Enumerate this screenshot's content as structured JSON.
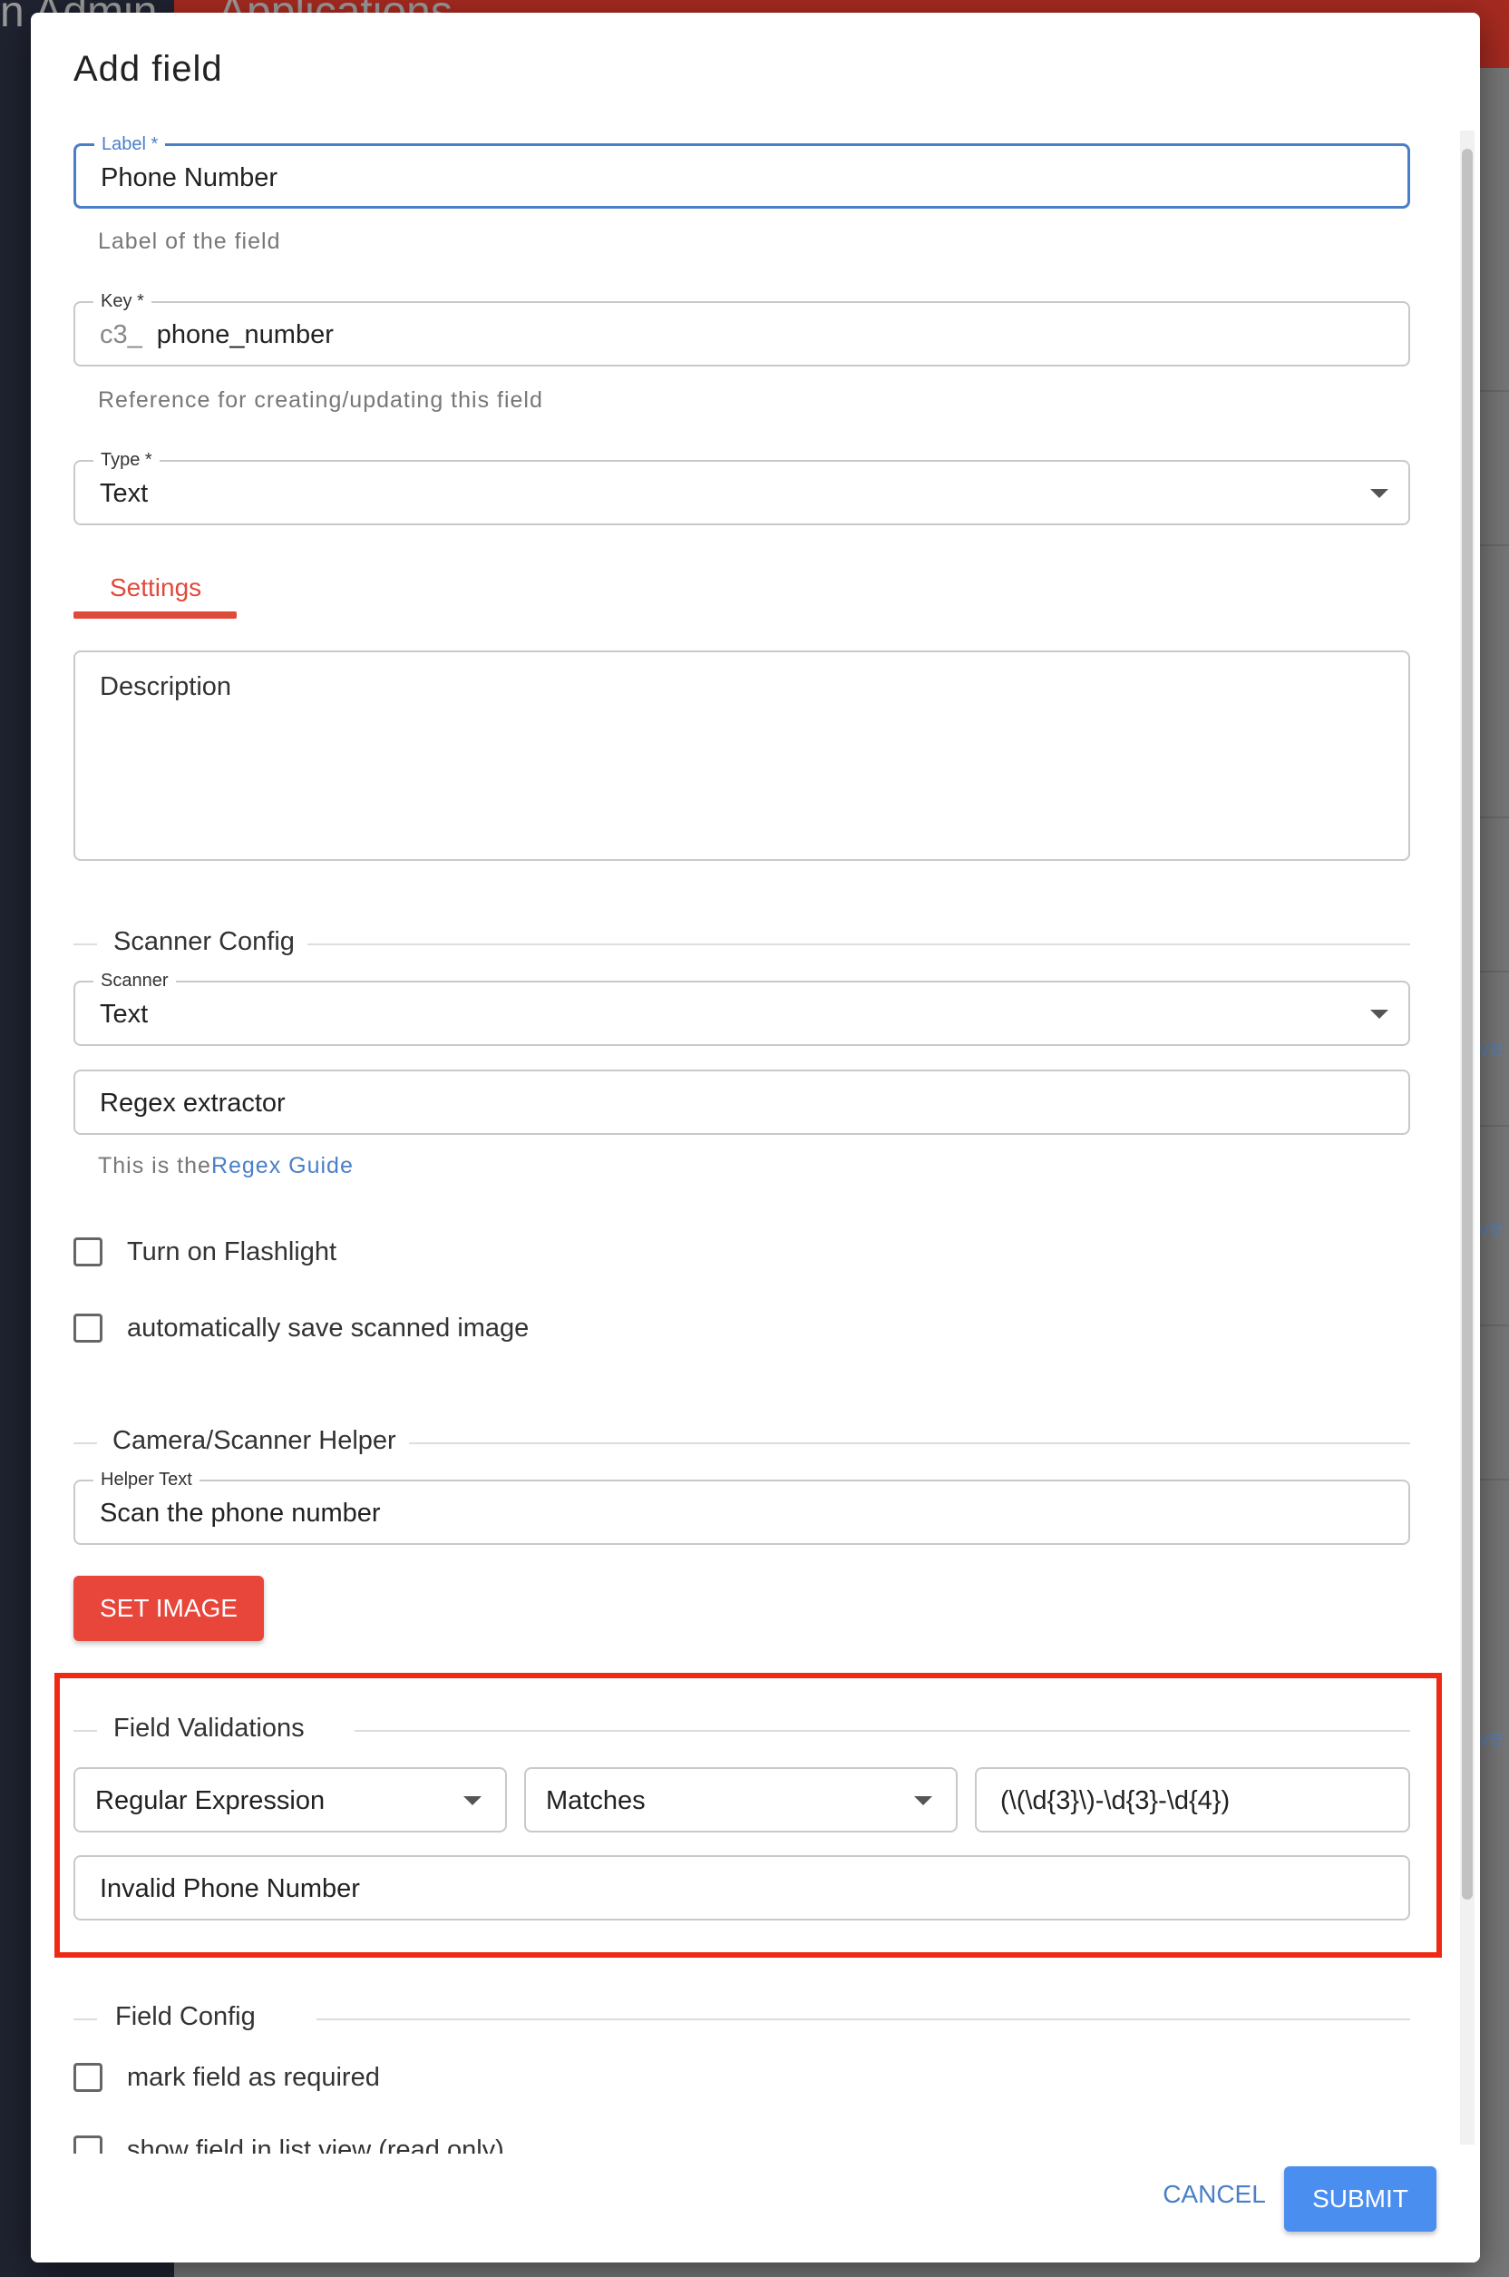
{
  "background": {
    "header_left": "n Admin",
    "header_right": "Applications",
    "side_text": [
      "ve",
      "ve",
      "ve"
    ]
  },
  "dialog": {
    "title": "Add field",
    "label_field": {
      "label": "Label *",
      "value": "Phone Number",
      "helper": "Label of the field"
    },
    "key_field": {
      "label": "Key *",
      "prefix": "c3_",
      "value": "phone_number",
      "helper": "Reference for creating/updating this field"
    },
    "type_field": {
      "label": "Type *",
      "value": "Text"
    },
    "tabs": [
      {
        "label": "Settings",
        "active": true
      }
    ],
    "description": {
      "placeholder": "Description"
    },
    "scanner_config": {
      "title": "Scanner Config",
      "scanner": {
        "label": "Scanner",
        "value": "Text"
      },
      "regex_extractor": {
        "placeholder": "Regex extractor"
      },
      "helper_prefix": "This is the",
      "helper_link": "Regex Guide"
    },
    "checkboxes": [
      {
        "label": "Turn on Flashlight",
        "checked": false
      },
      {
        "label": "automatically save scanned image",
        "checked": false
      }
    ],
    "camera_helper": {
      "title": "Camera/Scanner Helper",
      "helper_text": {
        "label": "Helper Text",
        "value": "Scan the phone number"
      },
      "set_image_label": "SET IMAGE"
    },
    "field_validations": {
      "title": "Field Validations",
      "rule_type": "Regular Expression",
      "operator": "Matches",
      "pattern": "(\\(\\d{3}\\)-\\d{3}-\\d{4})",
      "error_message": "Invalid Phone Number"
    },
    "field_config": {
      "title": "Field Config",
      "checkboxes": [
        {
          "label": "mark field as required",
          "checked": false
        },
        {
          "label": "show field in  list view (read only)",
          "checked": false
        }
      ]
    },
    "footer": {
      "cancel_label": "CANCEL",
      "submit_label": "SUBMIT"
    }
  },
  "colors": {
    "accent_blue": "#4a7fc8",
    "accent_red": "#e04a3a",
    "submit_blue": "#4a8ef0",
    "highlight_red": "#ee2a14"
  }
}
